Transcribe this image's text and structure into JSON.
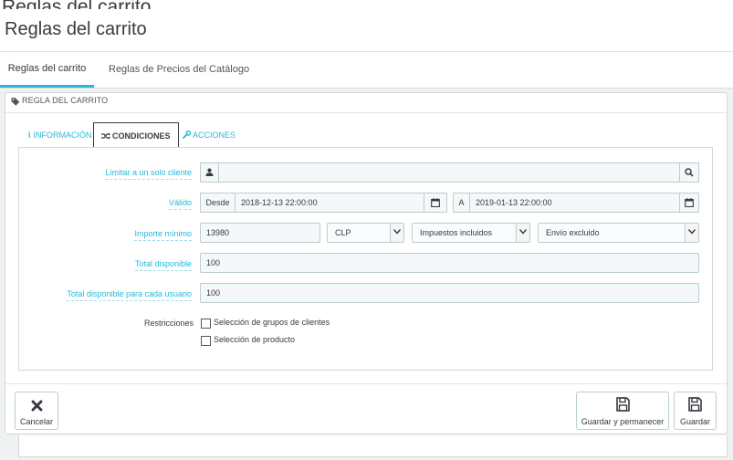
{
  "header": {
    "ghost_title": "Reglas del carrito",
    "title": "Reglas del carrito"
  },
  "tabs": [
    {
      "label": "Reglas del carrito",
      "active": true
    },
    {
      "label": "Reglas de Precios del Catálogo",
      "active": false
    }
  ],
  "panel": {
    "heading": "REGLA DEL CARRITO",
    "heading_icon": "tag-icon",
    "subtabs": [
      {
        "label": "INFORMACIÓN",
        "icon": "info-icon",
        "active": false
      },
      {
        "label": "CONDICIONES",
        "icon": "random-icon",
        "active": true
      },
      {
        "label": "ACCIONES",
        "icon": "wrench-icon",
        "active": false
      }
    ]
  },
  "form": {
    "customer": {
      "label": "Limitar a un solo cliente",
      "value": "",
      "icon": "user-icon",
      "search_icon": "search-icon"
    },
    "valid": {
      "label": "Válido",
      "from_label": "Desde",
      "from_value": "2018-12-13 22:00:00",
      "to_label": "A",
      "to_value": "2019-01-13 22:00:00",
      "calendar_icon": "calendar-icon"
    },
    "minimum": {
      "label": "Importe mínimo",
      "value": "13980",
      "currency": "CLP",
      "tax": "Impuestos incluidos",
      "shipping": "Envío excluido"
    },
    "total_available": {
      "label": "Total disponible",
      "value": "100"
    },
    "total_per_user": {
      "label": "Total disponible para cada usuario",
      "value": "100"
    },
    "restrictions": {
      "label": "Restricciones",
      "options": [
        {
          "label": "Selección de grupos de clientes",
          "checked": false
        },
        {
          "label": "Selección de producto",
          "checked": false
        }
      ]
    }
  },
  "footer": {
    "cancel_label": "Cancelar",
    "save_stay_label": "Guardar y permanecer",
    "save_label": "Guardar"
  },
  "colors": {
    "accent": "#25b9d7",
    "text": "#363a41",
    "background": "#eff1f2",
    "input_bg": "#f5f8f9",
    "border": "#bbcdd2"
  }
}
